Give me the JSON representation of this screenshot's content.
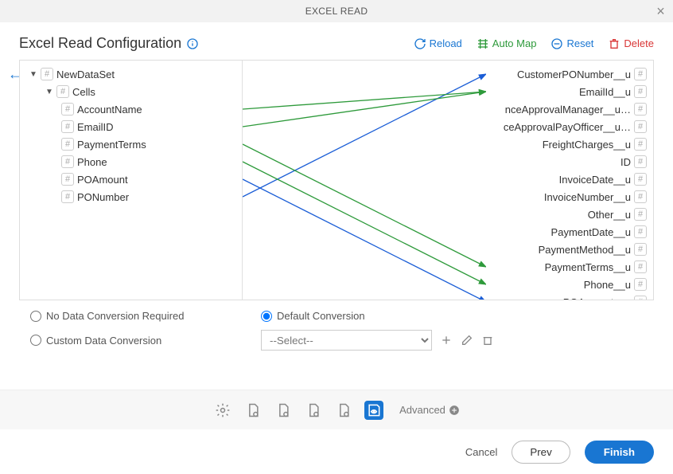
{
  "window": {
    "title": "EXCEL READ"
  },
  "header": {
    "title": "Excel Read Configuration"
  },
  "actions": {
    "reload": "Reload",
    "automap": "Auto Map",
    "reset": "Reset",
    "delete": "Delete"
  },
  "source_tree": {
    "root": "NewDataSet",
    "group": "Cells",
    "fields": [
      "AccountName",
      "EmailID",
      "PaymentTerms",
      "Phone",
      "POAmount",
      "PONumber"
    ]
  },
  "target_fields": [
    "CustomerPONumber__u",
    "EmailId__u",
    "…nceApprovalManager__u",
    "…ceApprovalPayOfficer__u",
    "FreightCharges__u",
    "ID",
    "InvoiceDate__u",
    "InvoiceNumber__u",
    "Other__u",
    "PaymentDate__u",
    "PaymentMethod__u",
    "PaymentTerms__u",
    "Phone__u",
    "POAmount__u"
  ],
  "mappings": [
    {
      "from": "PONumber",
      "to": "CustomerPONumber__u",
      "color": "#1a5dd6"
    },
    {
      "from": "AccountName",
      "to": "EmailId__u",
      "color": "#2e9a3b"
    },
    {
      "from": "EmailID",
      "to": "EmailId__u",
      "color": "#2e9a3b"
    },
    {
      "from": "PaymentTerms",
      "to": "PaymentTerms__u",
      "color": "#2e9a3b"
    },
    {
      "from": "Phone",
      "to": "Phone__u",
      "color": "#2e9a3b"
    },
    {
      "from": "POAmount",
      "to": "POAmount__u",
      "color": "#1a5dd6"
    }
  ],
  "conversion": {
    "none_label": "No Data Conversion Required",
    "default_label": "Default Conversion",
    "custom_label": "Custom Data Conversion",
    "select_placeholder": "--Select--",
    "selected_radio": "default"
  },
  "stepbar": {
    "advanced_label": "Advanced"
  },
  "footer": {
    "cancel": "Cancel",
    "prev": "Prev",
    "finish": "Finish"
  },
  "colors": {
    "green": "#2e9a3b",
    "blue": "#1a5dd6",
    "accent": "#1976d2"
  }
}
